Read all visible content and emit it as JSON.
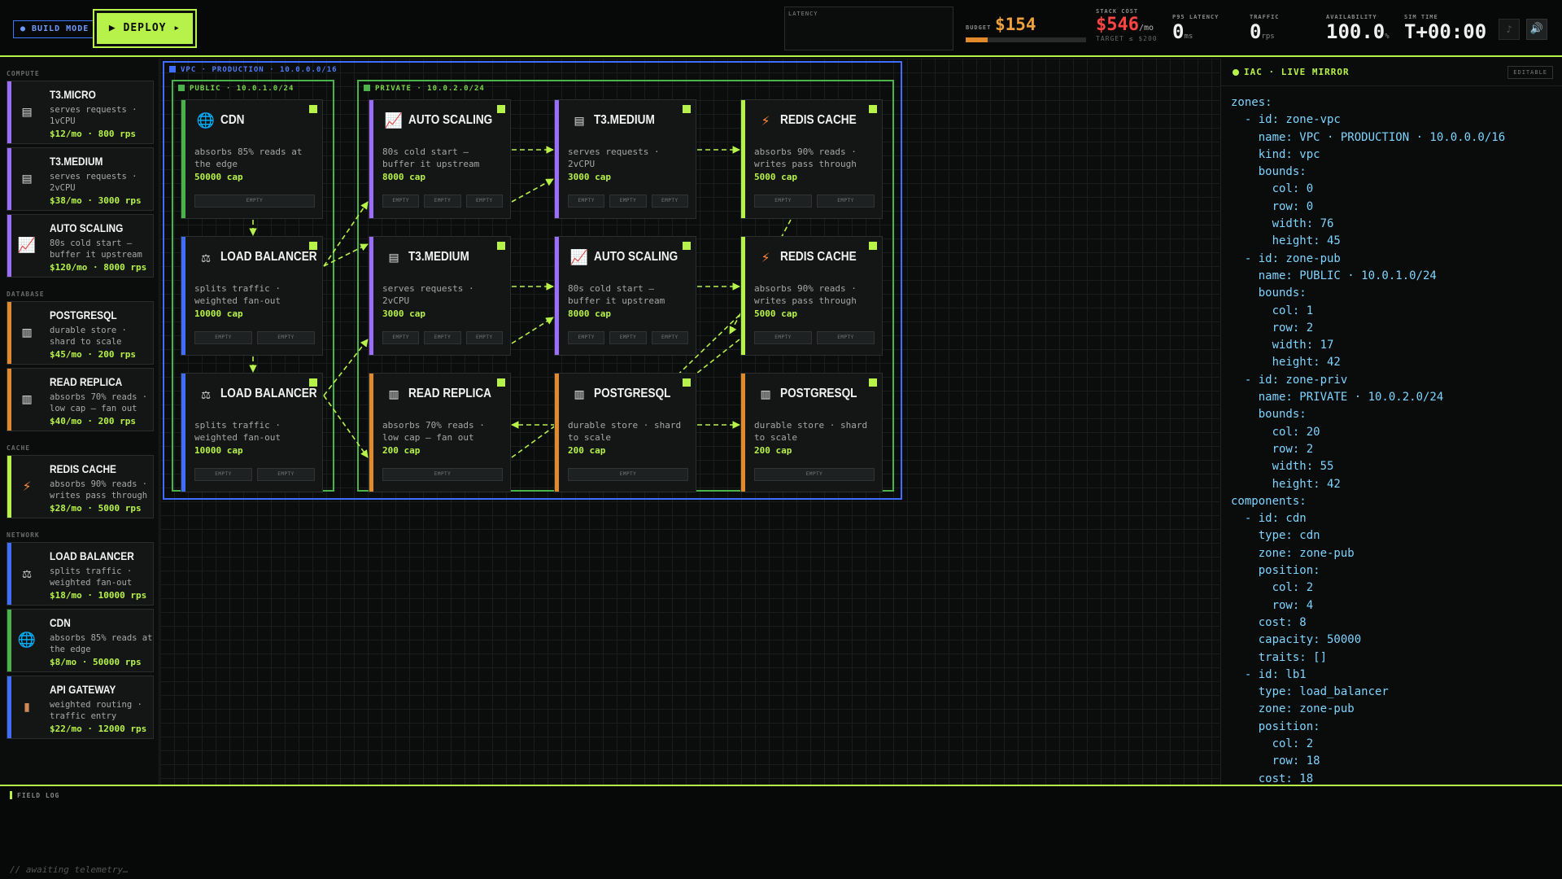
{
  "topbar": {
    "build_mode": "● BUILD MODE",
    "deploy": "▶ DEPLOY ▸",
    "latency_label": "LATENCY",
    "budget_label": "BUDGET",
    "budget_value": "$154",
    "budget_fill_percent": 18,
    "stack_label": "STACK COST",
    "stack_value": "$546",
    "stack_unit": "/mo",
    "stack_target": "TARGET ≤ $200",
    "p95_label": "P95 LATENCY",
    "p95_value": "0",
    "p95_unit": "ms",
    "traffic_label": "TRAFFIC",
    "traffic_value": "0",
    "traffic_unit": "rps",
    "avail_label": "AVAILABILITY",
    "avail_value": "100.0",
    "avail_unit": "%",
    "simtime_label": "SIM TIME",
    "simtime_value": "T+00:00",
    "music_icon": "♪",
    "sound_icon": "🔊"
  },
  "palette": {
    "categories": [
      {
        "label": "COMPUTE",
        "items": [
          {
            "name": "T3.MICRO",
            "desc": "serves requests · 1vCPU",
            "price": "$12/mo · 800 rps",
            "color": "#9b6dff",
            "icon": "server-icon"
          },
          {
            "name": "T3.MEDIUM",
            "desc": "serves requests · 2vCPU",
            "price": "$38/mo · 3000 rps",
            "color": "#9b6dff",
            "icon": "server-icon"
          },
          {
            "name": "AUTO SCALING",
            "desc": "80s cold start — buffer it upstream",
            "price": "$120/mo · 8000 rps",
            "color": "#9b6dff",
            "icon": "chart-up-icon"
          }
        ]
      },
      {
        "label": "DATABASE",
        "items": [
          {
            "name": "POSTGRESQL",
            "desc": "durable store · shard to scale",
            "price": "$45/mo · 200 rps",
            "color": "#e08a2c",
            "icon": "database-icon"
          },
          {
            "name": "READ REPLICA",
            "desc": "absorbs 70% reads · low cap — fan out",
            "price": "$40/mo · 200 rps",
            "color": "#e08a2c",
            "icon": "database-icon"
          }
        ]
      },
      {
        "label": "CACHE",
        "items": [
          {
            "name": "REDIS CACHE",
            "desc": "absorbs 90% reads · writes pass through",
            "price": "$28/mo · 5000 rps",
            "color": "#b6f24a",
            "icon": "lightning-icon"
          }
        ]
      },
      {
        "label": "NETWORK",
        "items": [
          {
            "name": "LOAD BALANCER",
            "desc": "splits traffic · weighted fan-out",
            "price": "$18/mo · 10000 rps",
            "color": "#3f6dff",
            "icon": "scales-icon"
          },
          {
            "name": "CDN",
            "desc": "absorbs 85% reads at the edge",
            "price": "$8/mo · 50000 rps",
            "color": "#4ab44a",
            "icon": "globe-icon"
          },
          {
            "name": "API GATEWAY",
            "desc": "weighted routing · traffic entry",
            "price": "$22/mo · 12000 rps",
            "color": "#3f6dff",
            "icon": "gateway-icon"
          }
        ]
      }
    ]
  },
  "zones": {
    "vpc": "VPC · PRODUCTION · 10.0.0.0/16",
    "pub": "PUBLIC · 10.0.1.0/24",
    "priv": "PRIVATE · 10.0.2.0/24"
  },
  "slot_label": "EMPTY",
  "cards": [
    {
      "title": "CDN",
      "desc": "absorbs 85% reads at the edge",
      "cap": "50000 cap",
      "color": "#4ab44a",
      "icon": "globe-icon",
      "slots": 1
    },
    {
      "title": "AUTO SCALING",
      "desc": "80s cold start — buffer it upstream",
      "cap": "8000 cap",
      "color": "#9b6dff",
      "icon": "chart-up-icon",
      "slots": 3
    },
    {
      "title": "T3.MEDIUM",
      "desc": "serves requests · 2vCPU",
      "cap": "3000 cap",
      "color": "#9b6dff",
      "icon": "server-icon",
      "slots": 3
    },
    {
      "title": "REDIS CACHE",
      "desc": "absorbs 90% reads · writes pass through",
      "cap": "5000 cap",
      "color": "#b6f24a",
      "icon": "lightning-icon",
      "slots": 2
    },
    {
      "title": "LOAD BALANCER",
      "desc": "splits traffic · weighted fan-out",
      "cap": "10000 cap",
      "color": "#3f6dff",
      "icon": "scales-icon",
      "slots": 2
    },
    {
      "title": "T3.MEDIUM",
      "desc": "serves requests · 2vCPU",
      "cap": "3000 cap",
      "color": "#9b6dff",
      "icon": "server-icon",
      "slots": 3
    },
    {
      "title": "AUTO SCALING",
      "desc": "80s cold start — buffer it upstream",
      "cap": "8000 cap",
      "color": "#9b6dff",
      "icon": "chart-up-icon",
      "slots": 3
    },
    {
      "title": "REDIS CACHE",
      "desc": "absorbs 90% reads · writes pass through",
      "cap": "5000 cap",
      "color": "#b6f24a",
      "icon": "lightning-icon",
      "slots": 2
    },
    {
      "title": "LOAD BALANCER",
      "desc": "splits traffic · weighted fan-out",
      "cap": "10000 cap",
      "color": "#3f6dff",
      "icon": "scales-icon",
      "slots": 2
    },
    {
      "title": "READ REPLICA",
      "desc": "absorbs 70% reads · low cap — fan out",
      "cap": "200 cap",
      "color": "#e08a2c",
      "icon": "database-icon",
      "slots": 1
    },
    {
      "title": "POSTGRESQL",
      "desc": "durable store · shard to scale",
      "cap": "200 cap",
      "color": "#e08a2c",
      "icon": "database-icon",
      "slots": 1
    },
    {
      "title": "POSTGRESQL",
      "desc": "durable store · shard to scale",
      "cap": "200 cap",
      "color": "#e08a2c",
      "icon": "database-icon",
      "slots": 1
    }
  ],
  "iac": {
    "title": "IAC · LIVE MIRROR",
    "editable": "EDITABLE",
    "lines": [
      "zones:",
      "  - id: zone-vpc",
      "    name: VPC · PRODUCTION · 10.0.0.0/16",
      "    kind: vpc",
      "    bounds:",
      "      col: 0",
      "      row: 0",
      "      width: 76",
      "      height: 45",
      "  - id: zone-pub",
      "    name: PUBLIC · 10.0.1.0/24",
      "    bounds:",
      "      col: 1",
      "      row: 2",
      "      width: 17",
      "      height: 42",
      "  - id: zone-priv",
      "    name: PRIVATE · 10.0.2.0/24",
      "    bounds:",
      "      col: 20",
      "      row: 2",
      "      width: 55",
      "      height: 42",
      "components:",
      "  - id: cdn",
      "    type: cdn",
      "    zone: zone-pub",
      "    position:",
      "      col: 2",
      "      row: 4",
      "    cost: 8",
      "    capacity: 50000",
      "    traits: []",
      "  - id: lb1",
      "    type: load_balancer",
      "    zone: zone-pub",
      "    position:",
      "      col: 2",
      "      row: 18",
      "    cost: 18"
    ]
  },
  "fieldlog": {
    "title": "FIELD LOG",
    "message": "// awaiting telemetry…"
  }
}
